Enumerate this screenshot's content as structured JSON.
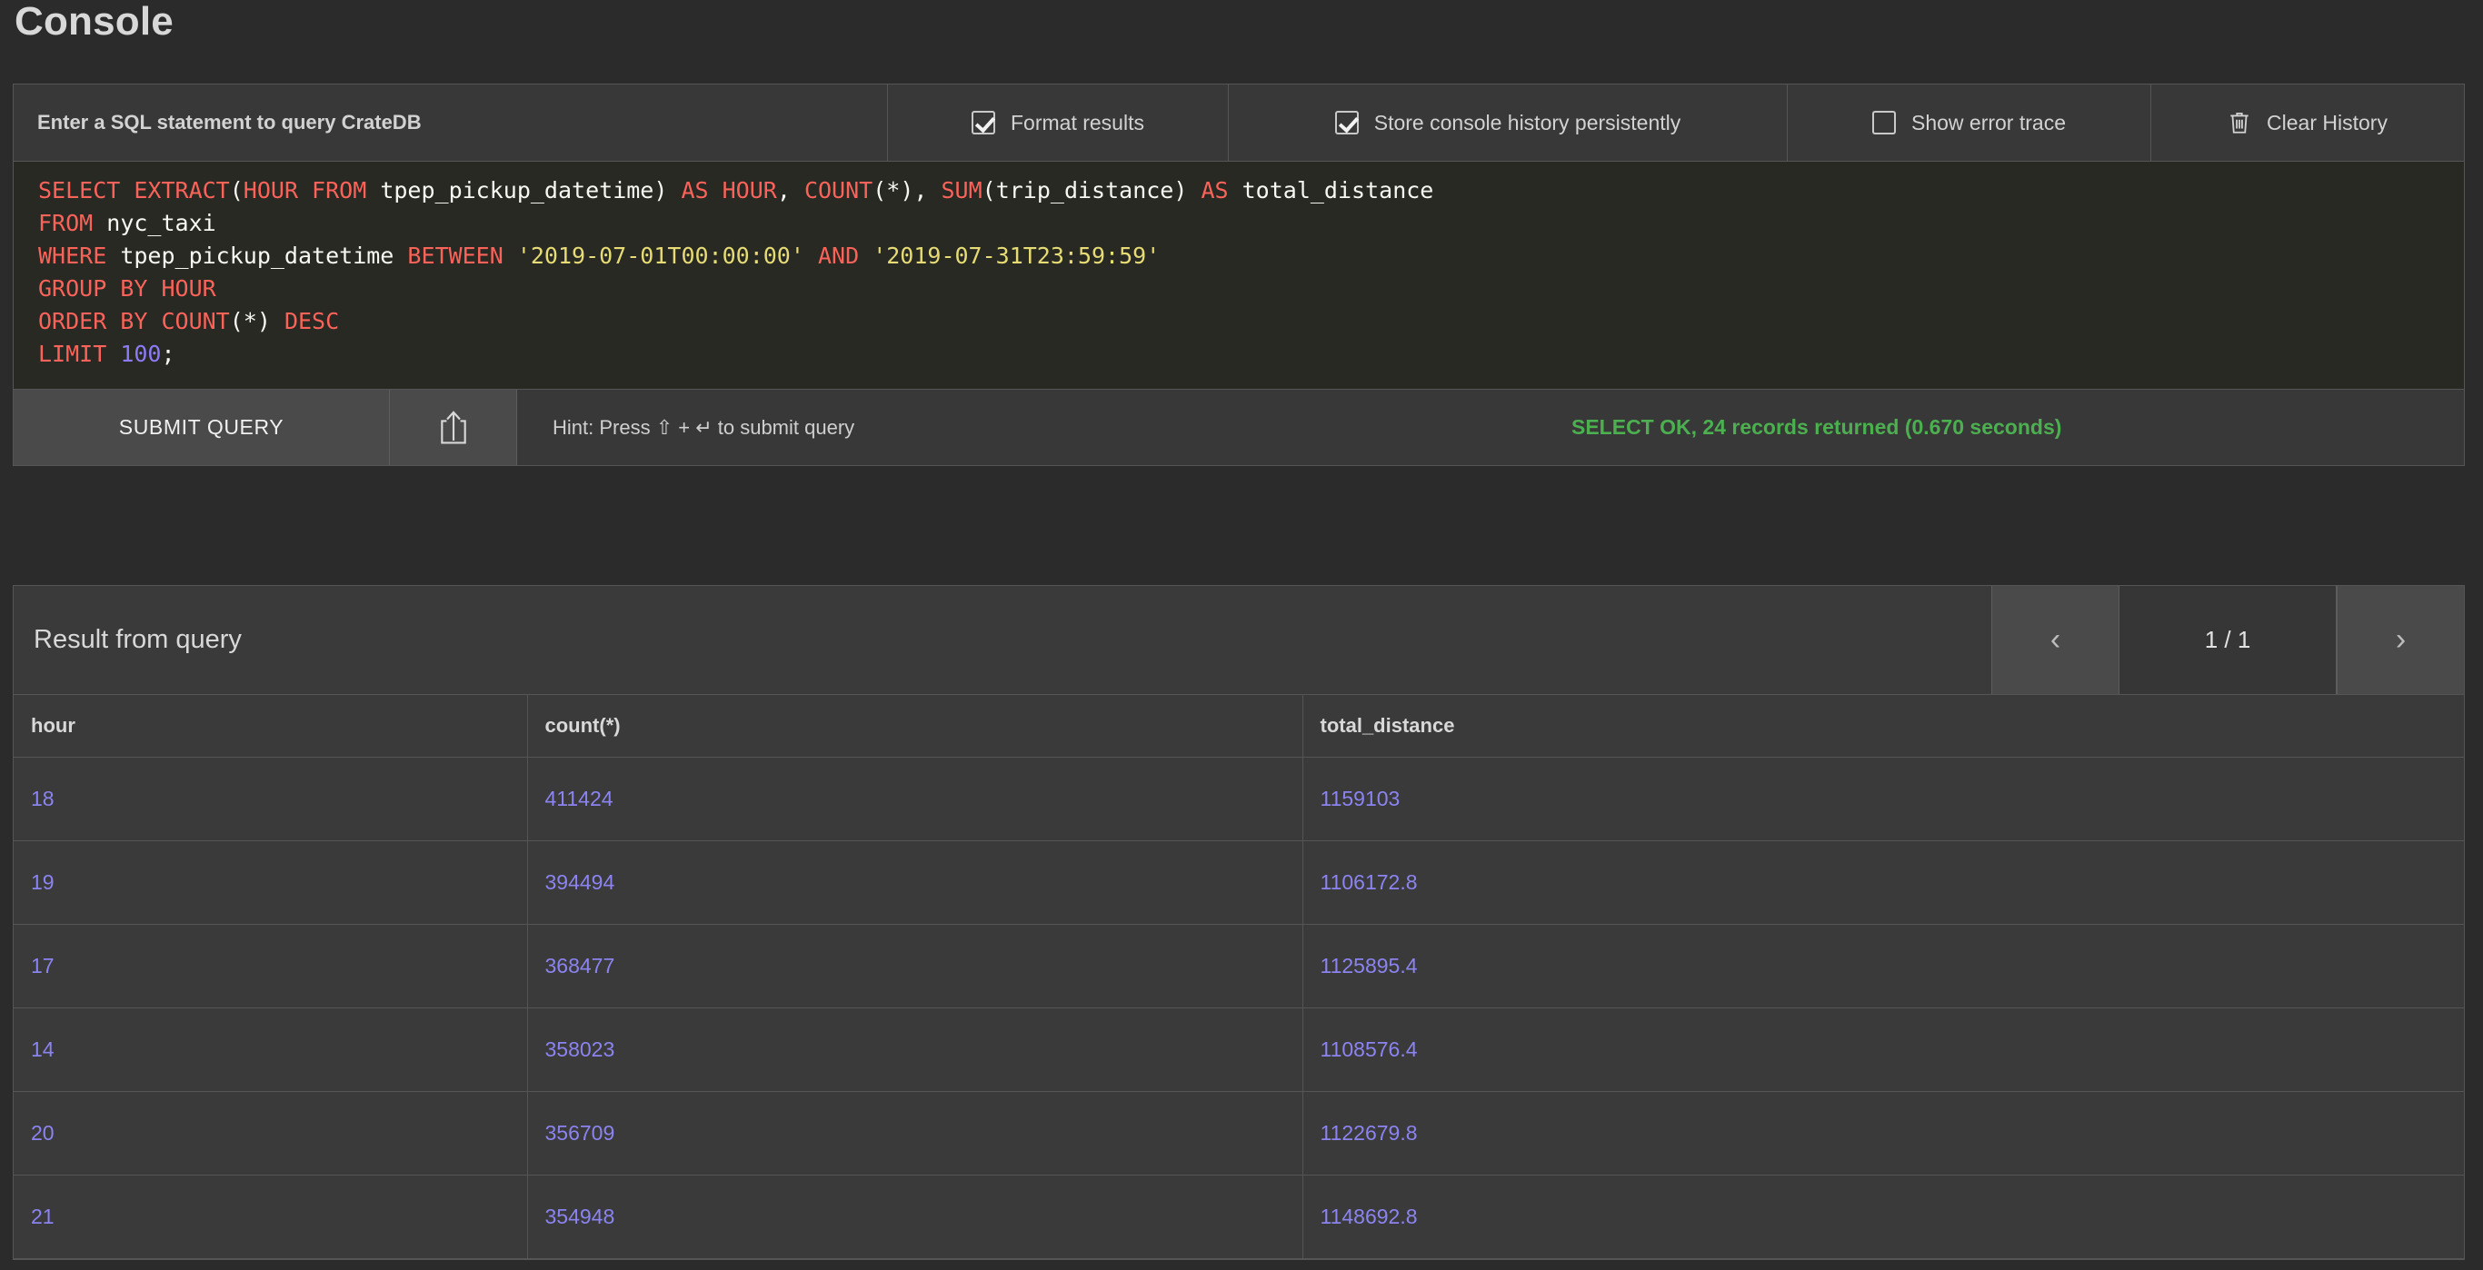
{
  "page": {
    "title": "Console"
  },
  "toolbar": {
    "prompt_label": "Enter a SQL statement to query CrateDB",
    "format_results": {
      "label": "Format results",
      "checked": true
    },
    "store_history": {
      "label": "Store console history persistently",
      "checked": true
    },
    "show_error_trace": {
      "label": "Show error trace",
      "checked": false
    },
    "clear_history": {
      "label": "Clear History",
      "icon": "trash-icon"
    }
  },
  "editor": {
    "lines": [
      [
        {
          "t": "SELECT",
          "c": "kw"
        },
        {
          "t": " ",
          "c": "pl"
        },
        {
          "t": "EXTRACT",
          "c": "kw"
        },
        {
          "t": "(",
          "c": "pl"
        },
        {
          "t": "HOUR FROM",
          "c": "kw"
        },
        {
          "t": " tpep_pickup_datetime) ",
          "c": "pl"
        },
        {
          "t": "AS",
          "c": "kw"
        },
        {
          "t": " ",
          "c": "pl"
        },
        {
          "t": "HOUR",
          "c": "kw"
        },
        {
          "t": ", ",
          "c": "pl"
        },
        {
          "t": "COUNT",
          "c": "kw"
        },
        {
          "t": "(*), ",
          "c": "pl"
        },
        {
          "t": "SUM",
          "c": "kw"
        },
        {
          "t": "(trip_distance) ",
          "c": "pl"
        },
        {
          "t": "AS",
          "c": "kw"
        },
        {
          "t": " total_distance",
          "c": "pl"
        }
      ],
      [
        {
          "t": "FROM",
          "c": "kw"
        },
        {
          "t": " nyc_taxi",
          "c": "pl"
        }
      ],
      [
        {
          "t": "WHERE",
          "c": "kw"
        },
        {
          "t": " tpep_pickup_datetime ",
          "c": "pl"
        },
        {
          "t": "BETWEEN",
          "c": "kw"
        },
        {
          "t": " ",
          "c": "pl"
        },
        {
          "t": "'2019-07-01T00:00:00'",
          "c": "str"
        },
        {
          "t": " ",
          "c": "pl"
        },
        {
          "t": "AND",
          "c": "kw"
        },
        {
          "t": " ",
          "c": "pl"
        },
        {
          "t": "'2019-07-31T23:59:59'",
          "c": "str"
        }
      ],
      [
        {
          "t": "GROUP BY HOUR",
          "c": "kw"
        }
      ],
      [
        {
          "t": "ORDER BY COUNT",
          "c": "kw"
        },
        {
          "t": "(*) ",
          "c": "pl"
        },
        {
          "t": "DESC",
          "c": "kw"
        }
      ],
      [
        {
          "t": "LIMIT",
          "c": "kw"
        },
        {
          "t": " ",
          "c": "pl"
        },
        {
          "t": "100",
          "c": "num"
        },
        {
          "t": ";",
          "c": "pl"
        }
      ]
    ],
    "raw_sql": "SELECT EXTRACT(HOUR FROM tpep_pickup_datetime) AS HOUR, COUNT(*), SUM(trip_distance) AS total_distance\nFROM nyc_taxi\nWHERE tpep_pickup_datetime BETWEEN '2019-07-01T00:00:00' AND '2019-07-31T23:59:59'\nGROUP BY HOUR\nORDER BY COUNT(*) DESC\nLIMIT 100;"
  },
  "submit_bar": {
    "submit_label": "SUBMIT QUERY",
    "share_icon": "share-upload-icon",
    "hint": "Hint: Press ⇧ + ↵ to submit query",
    "status": "SELECT OK, 24 records returned (0.670 seconds)",
    "status_color": "#4caf50"
  },
  "result": {
    "title": "Result from query",
    "prev_label": "‹",
    "next_label": "›",
    "page_info": "1 / 1",
    "columns": [
      "hour",
      "count(*)",
      "total_distance"
    ],
    "rows": [
      [
        "18",
        "411424",
        "1159103"
      ],
      [
        "19",
        "394494",
        "1106172.8"
      ],
      [
        "17",
        "368477",
        "1125895.4"
      ],
      [
        "14",
        "358023",
        "1108576.4"
      ],
      [
        "20",
        "356709",
        "1122679.8"
      ],
      [
        "21",
        "354948",
        "1148692.8"
      ]
    ]
  },
  "colors": {
    "background": "#2b2b2b",
    "panel": "#3a3a3a",
    "editor_bg": "#282923",
    "keyword": "#f9635a",
    "string": "#e6db74",
    "number": "#8b7bf7",
    "cell_value": "#8b84f0",
    "success": "#4caf50"
  }
}
